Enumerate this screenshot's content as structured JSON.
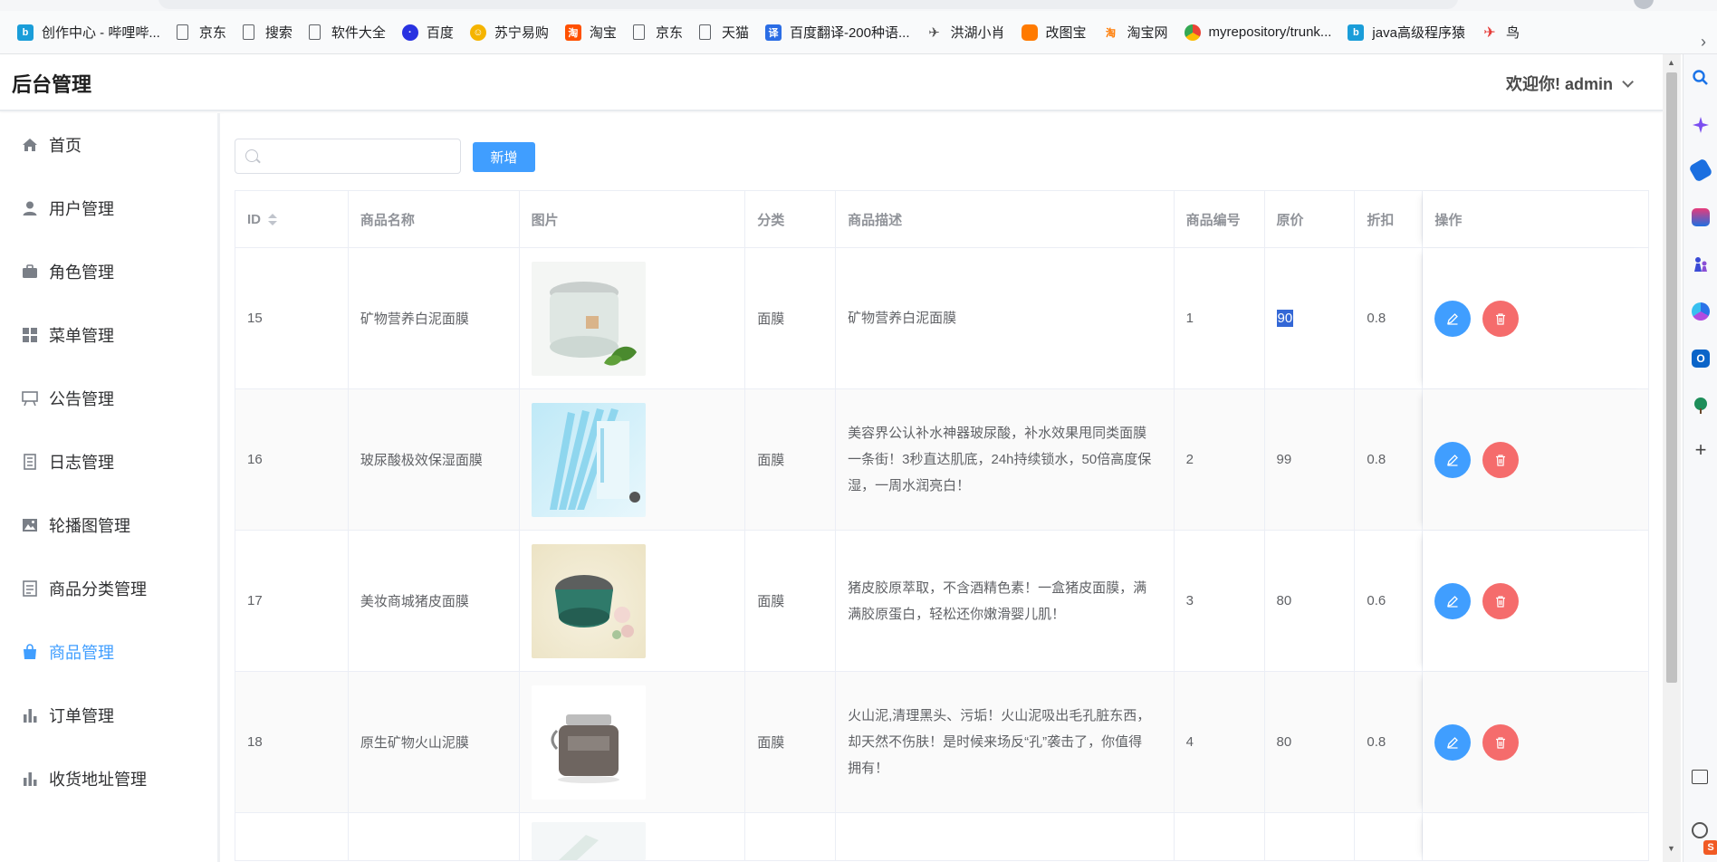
{
  "bookmarks": [
    {
      "label": "创作中心 - 哔哩哔...",
      "icon": "bilibili-icon",
      "color": "#1a9dd9"
    },
    {
      "label": "京东",
      "icon": "page-icon",
      "color": ""
    },
    {
      "label": "搜索",
      "icon": "page-icon",
      "color": ""
    },
    {
      "label": "软件大全",
      "icon": "page-icon",
      "color": ""
    },
    {
      "label": "百度",
      "icon": "baidu-paw-icon",
      "color": "#2932e1"
    },
    {
      "label": "苏宁易购",
      "icon": "suning-icon",
      "color": "#f5b400"
    },
    {
      "label": "淘宝",
      "icon": "taobao-icon",
      "color": "#ff5000"
    },
    {
      "label": "京东",
      "icon": "page-icon",
      "color": ""
    },
    {
      "label": "天猫",
      "icon": "page-icon",
      "color": ""
    },
    {
      "label": "百度翻译-200种语...",
      "icon": "baidu-translate-icon",
      "color": "#2b6de5"
    },
    {
      "label": "洪湖小肖",
      "icon": "bird-icon",
      "color": "#666666"
    },
    {
      "label": "改图宝",
      "icon": "gaitubao-icon",
      "color": "#ff7a00"
    },
    {
      "label": "淘宝网",
      "icon": "taobao-icon",
      "color": "#ff7a00"
    },
    {
      "label": "myrepository/trunk...",
      "icon": "chrome-icon",
      "color": "#4285f4"
    },
    {
      "label": "java高级程序猿",
      "icon": "bilibili-icon",
      "color": "#1a9dd9"
    },
    {
      "label": "鸟",
      "icon": "bird-red-icon",
      "color": "#e53935"
    }
  ],
  "header": {
    "title": "后台管理",
    "welcome": "欢迎你!  admin"
  },
  "menu": [
    {
      "label": "首页",
      "icon": "home-icon"
    },
    {
      "label": "用户管理",
      "icon": "user-icon"
    },
    {
      "label": "角色管理",
      "icon": "briefcase-icon"
    },
    {
      "label": "菜单管理",
      "icon": "grid-menu-icon"
    },
    {
      "label": "公告管理",
      "icon": "easel-icon"
    },
    {
      "label": "日志管理",
      "icon": "notebook-icon"
    },
    {
      "label": "轮播图管理",
      "icon": "picture-icon"
    },
    {
      "label": "商品分类管理",
      "icon": "document-icon"
    },
    {
      "label": "商品管理",
      "icon": "shopping-bag-icon",
      "active": true
    },
    {
      "label": "订单管理",
      "icon": "bar-chart-icon"
    },
    {
      "label": "收货地址管理",
      "icon": "bar-chart-icon"
    }
  ],
  "toolbar": {
    "search_placeholder": "",
    "add_label": "新增"
  },
  "table": {
    "headers": {
      "id": "ID",
      "name": "商品名称",
      "image": "图片",
      "category": "分类",
      "desc": "商品描述",
      "code": "商品编号",
      "price": "原价",
      "discount": "折扣",
      "ops": "操作"
    },
    "rows": [
      {
        "id": "15",
        "name": "矿物营养白泥面膜",
        "category": "面膜",
        "desc": "矿物营养白泥面膜",
        "code": "1",
        "price": "90",
        "discount": "0.8",
        "price_selected": true
      },
      {
        "id": "16",
        "name": "玻尿酸极效保湿面膜",
        "category": "面膜",
        "desc": "美容界公认补水神器玻尿酸，补水效果甩同类面膜一条街！3秒直达肌底，24h持续锁水，50倍高度保湿，一周水润亮白！",
        "code": "2",
        "price": "99",
        "discount": "0.8"
      },
      {
        "id": "17",
        "name": "美妆商城猪皮面膜",
        "category": "面膜",
        "desc": "猪皮胶原萃取，不含酒精色素！一盒猪皮面膜，满满胶原蛋白，轻松还你嫩滑婴儿肌！",
        "code": "3",
        "price": "80",
        "discount": "0.6"
      },
      {
        "id": "18",
        "name": "原生矿物火山泥膜",
        "category": "面膜",
        "desc": "火山泥,清理黑头、污垢！火山泥吸出毛孔脏东西，却天然不伤肤！是时候来场反“孔”袭击了，你值得拥有！",
        "code": "4",
        "price": "80",
        "discount": "0.8"
      }
    ]
  },
  "colors": {
    "primary": "#409eff",
    "danger": "#f56c6c",
    "selection": "#3367d6"
  }
}
